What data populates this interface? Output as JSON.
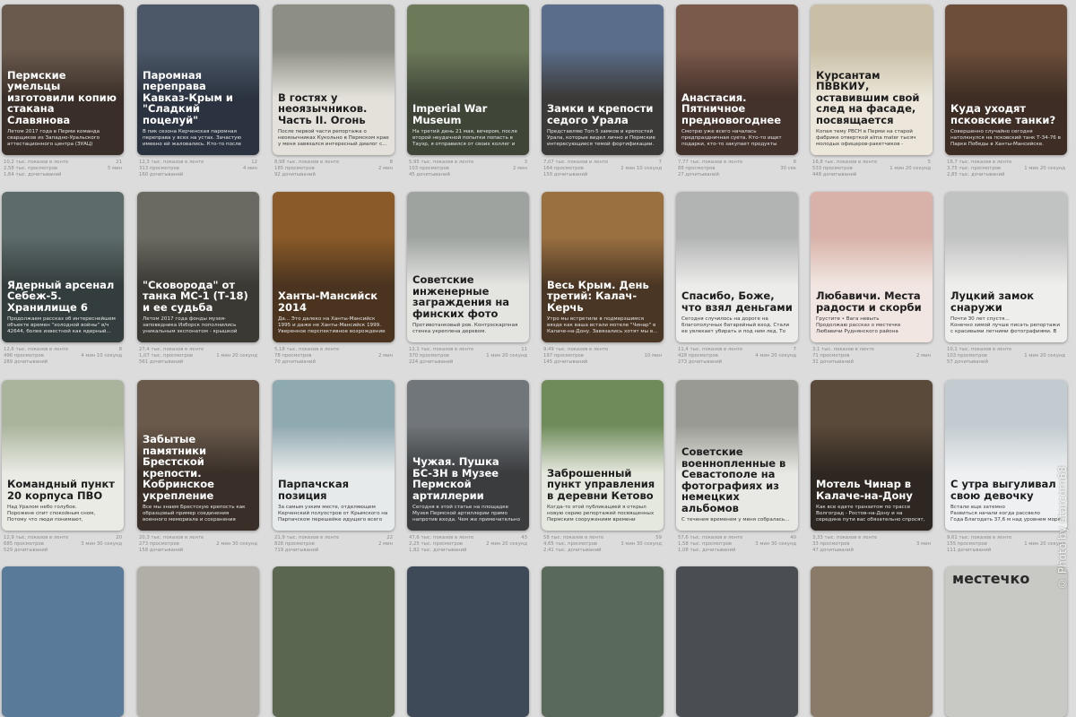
{
  "cards": [
    {
      "title": "Пермские умельцы изготовили копию стакана Славянова",
      "desc": "Летом 2017 года в Перми команда сварщиков из Западно-Уральского аттестационного центра (ЗУАЦ) реализовала амбициозный проект по...",
      "theme": "dark",
      "photo": "#6a5a4e",
      "grad": "#3a2f28",
      "stats": {
        "impressions": "10,2 тыс. показов в ленте",
        "views": "2,58 тыс. просмотров",
        "reads": "1,64 тыс. дочитываний",
        "likes": "21",
        "time": "5 мин"
      }
    },
    {
      "title": "Паромная переправа Кавказ-Крым и \"Сладкий поцелуй\"",
      "desc": "В пик сезона Керченская паромная переправа у всех на устах. Зачастую имеено ей жаловались. Кто-то после переправы становится злой и мрачный, а кто-то радост...",
      "theme": "dark",
      "photo": "#4c5868",
      "grad": "#2b3340",
      "stats": {
        "impressions": "12,3 тыс. показов в ленте",
        "views": "313 просмотров",
        "reads": "160 дочитываний",
        "likes": "12",
        "time": "4 мин"
      }
    },
    {
      "title": "В гостях у неоязычников. Часть II. Огонь",
      "desc": "После первой части репортажа о неоязычниках Кукольно в Пермском крае у меня завязался интересный диалог с...",
      "theme": "light",
      "photo": "#8d8e84",
      "grad": "#e3e1da",
      "stats": {
        "impressions": "8,98 тыс. показов в ленте",
        "views": "185 просмотров",
        "reads": "92 дочитываний",
        "likes": "8",
        "time": "2 мин"
      }
    },
    {
      "title": "Imperial War Museum",
      "desc": "На третий день 21 мая, вечером, после второй неудачной попытки попасть в Тауэр, я отправился от своих коллег и пошел смотреть мост Ватерлоо. Однако, выйдя и...",
      "theme": "dark",
      "photo": "#6d7a5a",
      "grad": "#3f4638",
      "stats": {
        "impressions": "5,95 тыс. показов в ленте",
        "views": "103 просмотров",
        "reads": "45 дочитываний",
        "likes": "3",
        "time": "2 мин"
      }
    },
    {
      "title": "Замки и крепости седого Урала",
      "desc": "Представляю Топ-5 замков и крепостей Урала, которые видел лично и Пермские интересующиеся темой фортификации. В 2016 году этот своеобразный материал недавно здесь на мало вдумы в определенных...",
      "theme": "dark",
      "photo": "#5a6d8a",
      "grad": "#3c3a38",
      "stats": {
        "impressions": "7,07 тыс. показов в ленте",
        "views": "164 просмотров",
        "reads": "150 дочитываний",
        "likes": "7",
        "time": "2 мин 10 секунд"
      }
    },
    {
      "title": "Анастасия. Пятничное предновогоднее",
      "desc": "Смотрю уже всего началась предпраздничная суета. Кто-то ищет подарки, кто-то закупает продукты или...",
      "theme": "dark",
      "photo": "#7a5a4a",
      "grad": "#43312b",
      "stats": {
        "impressions": "7,77 тыс. показов в ленте",
        "views": "88 просмотров",
        "reads": "27 дочитываний",
        "likes": "8",
        "time": "30 сек"
      }
    },
    {
      "title": "Курсантам ПВВКИУ, оставившим свой след на фасаде, посвящается",
      "desc": "Копая тему РВСН в Перми на старой фабрике отверткой alma mater тысяч молодых офицеров-ракетчиков - ПВВКИУ...",
      "theme": "light",
      "photo": "#c9bfa6",
      "grad": "#ece7da",
      "stats": {
        "impressions": "16,8 тыс. показов в ленте",
        "views": "533 просмотров",
        "reads": "448 дочитываний",
        "likes": "5",
        "time": "1 мин 20 секунд"
      }
    },
    {
      "title": "Куда уходят псковские танки?",
      "desc": "Совершенно случайно сегодня натолкнулся на псковский танк Т-34-76 в Парке Победы в Ханты-Мансийске. Шествие чувствую заставило меня сбежать с намеченного пути и подойти к легендарной машине...",
      "theme": "dark",
      "photo": "#6d4e3a",
      "grad": "#3d2d24",
      "stats": {
        "impressions": "18,7 тыс. показов в ленте",
        "views": "3,75 тыс. просмотров",
        "reads": "2,85 тыс. дочитываний",
        "likes": "",
        "time": "1 мин 20 секунд"
      }
    },
    {
      "title": "Ядерный арсенал Себеж-5. Хранилище 6",
      "desc": "Продолжаем рассказ об интереснейшем объекте времен \"холодной войны\" в/ч 42644, более известной как ядерный...",
      "theme": "dark",
      "photo": "#5d6b6a",
      "grad": "#343d3d",
      "stats": {
        "impressions": "12,6 тыс. показов в ленте",
        "views": "496 просмотров",
        "reads": "289 дочитываний",
        "likes": "8",
        "time": "4 мин 10 секунд"
      }
    },
    {
      "title": "\"Сковорода\" от танка МС-1 (Т-18) и ее судьба",
      "desc": "Летом 2017 года фонды музея-заповедника Изборск пополнились уникальным экспонатом - крышкой башенного люка...",
      "theme": "dark",
      "photo": "#6b6a62",
      "grad": "#3a3934",
      "stats": {
        "impressions": "27,4 тыс. показов в ленте",
        "views": "1,07 тыс. просмотров",
        "reads": "561 дочитываний",
        "likes": "",
        "time": "1 мин 20 секунд"
      }
    },
    {
      "title": "Ханты-Мансийск 2014",
      "desc": "Да... Это далеко на Ханты-Мансийск 1995 и даже не Ханты-Мансийск 1999. Уверенное перспективное возрождение столицы ее величины в этой столице Западной...",
      "theme": "dark",
      "photo": "#8a5a28",
      "grad": "#4a3420",
      "stats": {
        "impressions": "5,18 тыс. показов в ленте",
        "views": "78 просмотров",
        "reads": "70 дочитываний",
        "likes": "",
        "time": "2 мин"
      }
    },
    {
      "title": "Советские инженерные заграждения на финских фото",
      "desc": "Противотанковый ров. Контрэскарпная стенка укреплена деревом.",
      "theme": "light",
      "photo": "#9ea3a0",
      "grad": "#e4e4e1",
      "stats": {
        "impressions": "12,1 тыс. показов в ленте",
        "views": "370 просмотров",
        "reads": "224 дочитываний",
        "likes": "11",
        "time": "1 мин 20 секунд"
      }
    },
    {
      "title": "Весь Крым. День третий: Калач-Керчь",
      "desc": "Утро мы встретили в подмерзшимся вязде как ваша встали мотеле \"Чинар\" в Калаче-на-Дону. Завязались хотят мы в...",
      "theme": "dark",
      "photo": "#9a7040",
      "grad": "#4a3624",
      "stats": {
        "impressions": "9,49 тыс. показов в ленте",
        "views": "197 просмотров",
        "reads": "145 дочитываний",
        "likes": "",
        "time": "10 мин"
      }
    },
    {
      "title": "Спасибо, Боже, что взял деньгами",
      "desc": "Сегодня случилось на дороге на благополучных батарейный вход. Стали ее увлекает убирать и под ним лед. То тут, то там на дороге в поради образуются заторы из-за мелких и не очень аварий, в на...",
      "theme": "light",
      "photo": "#b2b4b4",
      "grad": "#ececea",
      "stats": {
        "impressions": "11,4 тыс. показов в ленте",
        "views": "428 просмотров",
        "reads": "273 дочитываний",
        "likes": "7",
        "time": "4 мин 20 секунд"
      }
    },
    {
      "title": "Любавичи. Места радости и скорби",
      "desc": "Грустите • Вага невыть\nПродолжаю рассказ о местечке Любавичи Руднянского района Смоленской области - крупнейшем заселенном религиозном...",
      "theme": "light",
      "photo": "#d8b2a8",
      "grad": "#f1e6e2",
      "stats": {
        "impressions": "3,1 тыс. показов в ленте",
        "views": "71 просмотров",
        "reads": "31 дочитываний",
        "likes": "",
        "time": "2 мин"
      }
    },
    {
      "title": "Луцкий замок снаружи",
      "desc": "Почти 30 лет спустя...\nКонечно зимой лучше писать репортажи с красивыми летними фотографиями. В этом году плана Луцку не повезло. В мае...",
      "theme": "light",
      "photo": "#c1c3c2",
      "grad": "#eeeeec",
      "stats": {
        "impressions": "10,1 тыс. показов в ленте",
        "views": "103 просмотров",
        "reads": "57 дочитываний",
        "likes": "",
        "time": "1 мин 20 секунд"
      }
    },
    {
      "title": "Командный пункт 20 корпуса ПВО",
      "desc": "Над Уралом небо голубое.\nПорожене спит спокойным сном,\nПотому что люди понимают,\nЧто на не спит солдаты ПВО",
      "theme": "light",
      "photo": "#aab49c",
      "grad": "#eaebe4",
      "stats": {
        "impressions": "12,9 тыс. показов в ленте",
        "views": "685 просмотров",
        "reads": "529 дочитываний",
        "likes": "20",
        "time": "3 мин 30 секунд"
      }
    },
    {
      "title": "Забытые памятники Брестской крепости. Кобринское укрепление",
      "desc": "Все мы знаем Брестскую крепость как образцовый пример соединения военного мемориала и сохранения памяти о...",
      "theme": "dark",
      "photo": "#6a5a4c",
      "grad": "#392f28",
      "stats": {
        "impressions": "20,3 тыс. показов в ленте",
        "views": "273 просмотров",
        "reads": "158 дочитываний",
        "likes": "",
        "time": "2 мин 30 секунд"
      }
    },
    {
      "title": "Парпачская позиция",
      "desc": "За самым узким месте, отделяющем Керченский полуостров от Крымского на Парпачском перешейке идущего всего 18 километров издавна строились...",
      "theme": "light",
      "photo": "#8fa9b0",
      "grad": "#e7eaea",
      "stats": {
        "impressions": "21,9 тыс. показов в ленте",
        "views": "826 просмотров",
        "reads": "719 дочитываний",
        "likes": "22",
        "time": "2 мин"
      }
    },
    {
      "title": "Чужая. Пушка БС-3Н в Музее Пермской артиллерии",
      "desc": "Сегодня в этой статье на площадке Музея Пермской артиллерии примо напротив входа. Чем же примечательно это орудие?",
      "theme": "dark",
      "photo": "#71767a",
      "grad": "#3a3c3e",
      "stats": {
        "impressions": "47,6 тыс. показов в ленте",
        "views": "2,25 тыс. просмотров",
        "reads": "1,82 тыс. дочитываний",
        "likes": "43",
        "time": "2 мин 20 секунд"
      }
    },
    {
      "title": "Заброшенный пункт управления в деревни Кетово",
      "desc": "Когда-то этой публикацией я открыл новую серию репортажей посвященных Пермским сооружениям времени \"холодной войны\" в...",
      "theme": "light",
      "photo": "#6f8b5a",
      "grad": "#e5e8de",
      "stats": {
        "impressions": "58 тыс. показов в ленте",
        "views": "4,65 тыс. просмотров",
        "reads": "2,41 тыс. дочитываний",
        "likes": "59",
        "time": "3 мин 30 секунд"
      }
    },
    {
      "title": "Советские военнопленные в Севастополе на фотографиях из немецких альбомов",
      "desc": "С теченем временем у меня собралась...",
      "theme": "light",
      "photo": "#9a9a94",
      "grad": "#e8e8e4",
      "stats": {
        "impressions": "57,6 тыс. показов в ленте",
        "views": "1,58 тыс. просмотров",
        "reads": "1,08 тыс. дочитываний",
        "likes": "40",
        "time": "3 мин 30 секунд"
      }
    },
    {
      "title": "Мотель Чинар в Калаче-на-Дону",
      "desc": "Как все едете транзитом по трассе Волгоград - Ростов-на-Дону и на середине пути вас обязательно спросят, а где ночевать в Калаче-на-Дону. Только в тогда заказать...",
      "theme": "dark",
      "photo": "#5a4a3a",
      "grad": "#2e2620",
      "stats": {
        "impressions": "3,33 тыс. показов в ленте",
        "views": "33 просмотров",
        "reads": "47 дочитываний",
        "likes": "",
        "time": "3 мин"
      }
    },
    {
      "title": "С утра выгуливал свою девочку",
      "desc": "Встали еще затемно\nРазвиться начали когда рассвело\nГода Благодать 37,6 м над уровнем моря",
      "theme": "light",
      "photo": "#c2cbd0",
      "grad": "#eef0f1",
      "stats": {
        "impressions": "9,61 тыс. показов в ленте",
        "views": "155 просмотров",
        "reads": "111 дочитываний",
        "likes": "",
        "time": "1 мин 20 секунд"
      }
    }
  ],
  "bottom_row": [
    {
      "photo": "#5a7a9a",
      "label": ""
    },
    {
      "photo": "#b0aea6",
      "label": ""
    },
    {
      "photo": "#5a6650",
      "label": ""
    },
    {
      "photo": "#3e4a58",
      "label": ""
    },
    {
      "photo": "#5a6a5a",
      "label": ""
    },
    {
      "photo": "#4a4e52",
      "label": ""
    },
    {
      "photo": "#8a7a68",
      "label": ""
    },
    {
      "photo": "#c8c8c4",
      "label": "местечко"
    }
  ],
  "watermark": "© Photo by starcom68"
}
